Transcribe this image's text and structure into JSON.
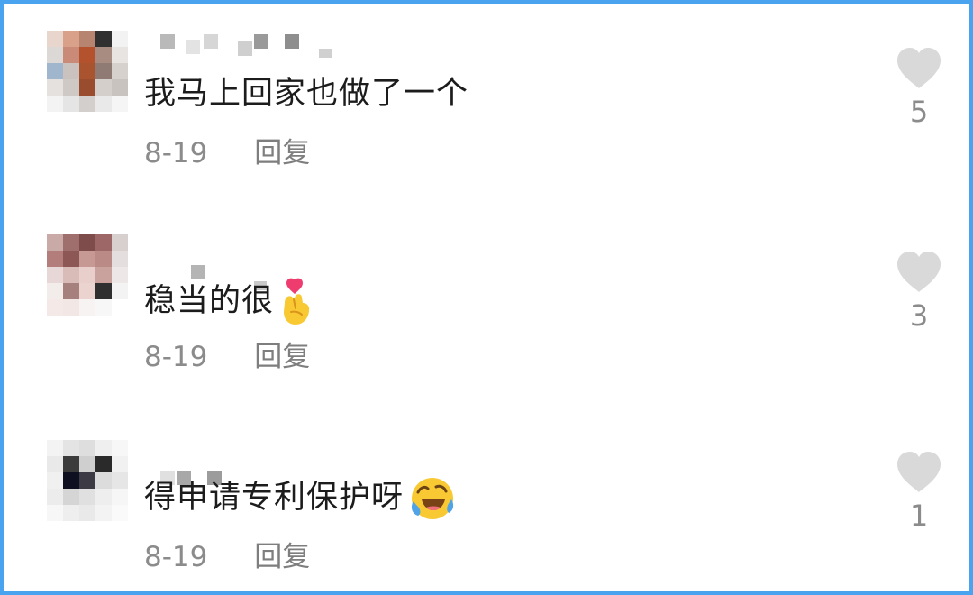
{
  "comments": [
    {
      "text": "我马上回家也做了一个",
      "date": "8-19",
      "reply_label": "回复",
      "like_count": "5",
      "emoji": ""
    },
    {
      "text": "稳当的很",
      "date": "8-19",
      "reply_label": "回复",
      "like_count": "3",
      "emoji": "finger-heart-emoji"
    },
    {
      "text": "得申请专利保护呀",
      "date": "8-19",
      "reply_label": "回复",
      "like_count": "1",
      "emoji": "rolling-on-floor-laughing-emoji"
    }
  ],
  "colors": {
    "border": "#4aa3ee",
    "text": "#1c1c1c",
    "meta": "#8b8b8b",
    "heart": "#d9d9d9"
  },
  "icons": {
    "like": "heart-icon",
    "avatar": "pixelated-avatar"
  }
}
